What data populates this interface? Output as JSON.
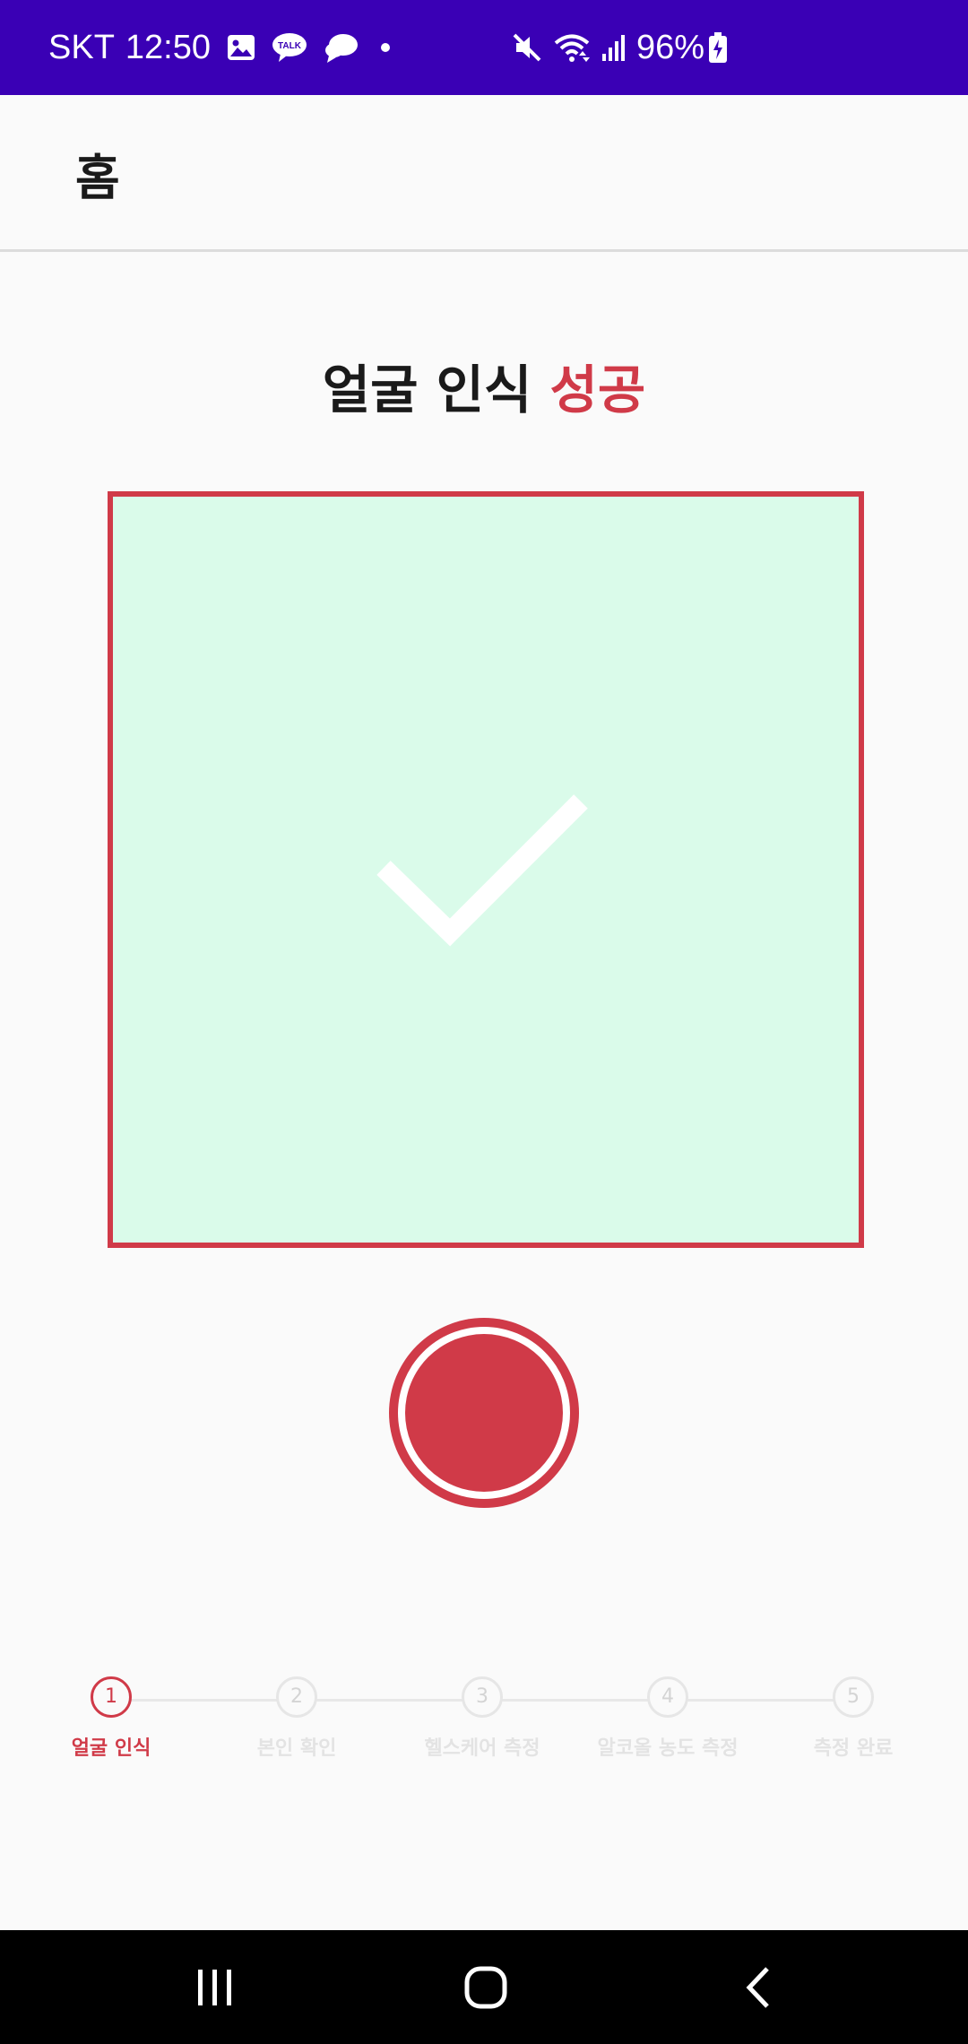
{
  "status_bar": {
    "carrier": "SKT",
    "time": "12:50",
    "notifications": [
      "gallery-icon",
      "kakaotalk-icon",
      "chat-bubble-icon",
      "dot-icon"
    ],
    "battery_percent": "96%",
    "icons": [
      "mute-icon",
      "wifi-icon",
      "signal-icon",
      "battery-charging-icon"
    ],
    "background_color": "#3a00b5"
  },
  "app_bar": {
    "title": "홈"
  },
  "headline": {
    "prefix": "얼굴 인식 ",
    "accent": "성공",
    "accent_color": "#d03a48"
  },
  "camera": {
    "state": "success",
    "background_color": "#dafbea",
    "border_color": "#d03a48",
    "icon": "check-icon"
  },
  "shutter": {
    "color": "#d03a48",
    "icon": "record-button"
  },
  "stepper": {
    "current_step": 1,
    "steps": [
      {
        "number": "1",
        "label": "얼굴 인식"
      },
      {
        "number": "2",
        "label": "본인 확인"
      },
      {
        "number": "3",
        "label": "헬스케어 측정"
      },
      {
        "number": "4",
        "label": "알코올 농도 측정"
      },
      {
        "number": "5",
        "label": "측정 완료"
      }
    ]
  },
  "nav_bar": {
    "buttons": [
      "recents-icon",
      "home-icon",
      "back-icon"
    ]
  }
}
